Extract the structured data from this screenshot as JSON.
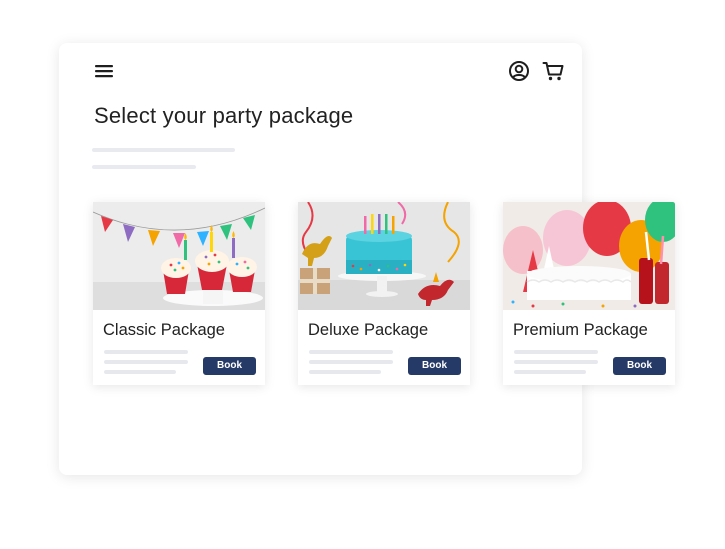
{
  "header": {
    "menu_icon": "hamburger-menu-icon",
    "account_icon": "user-circle-icon",
    "cart_icon": "shopping-cart-icon"
  },
  "page": {
    "title": "Select your party package"
  },
  "packages": [
    {
      "name": "Classic Package",
      "button": "Book",
      "image": "cupcakes-with-candles-and-bunting"
    },
    {
      "name": "Deluxe Package",
      "button": "Book",
      "image": "blue-birthday-cake-with-toy-dinosaurs"
    },
    {
      "name": "Premium Package",
      "button": "Book",
      "image": "white-cake-with-balloons-and-drinks"
    }
  ],
  "colors": {
    "button": "#263a68",
    "placeholder": "#e8eaf0",
    "text": "#222222"
  }
}
